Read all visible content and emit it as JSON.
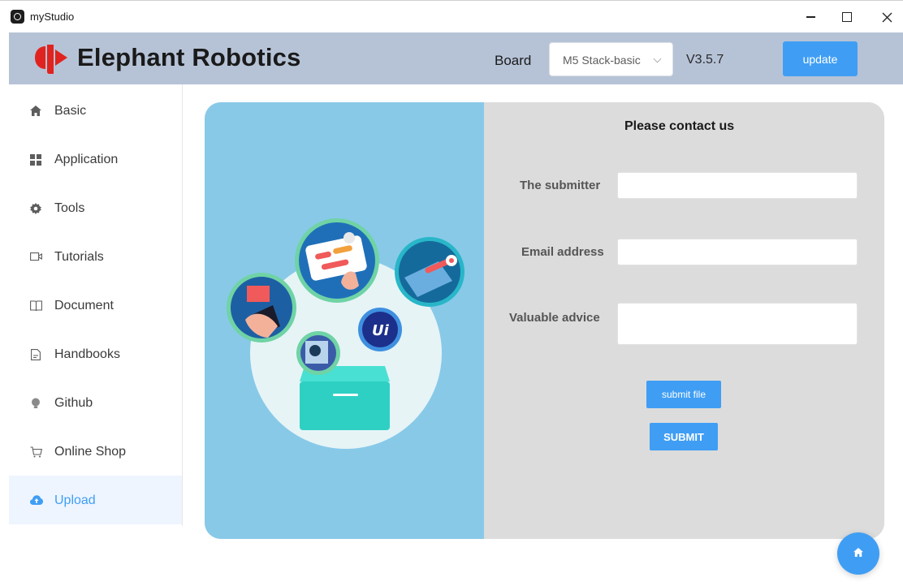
{
  "window": {
    "title": "myStudio"
  },
  "header": {
    "brand": "Elephant Robotics",
    "board_label": "Board",
    "board_value": "M5 Stack-basic",
    "version": "V3.5.7",
    "update_label": "update"
  },
  "sidebar": {
    "items": [
      {
        "label": "Basic",
        "icon": "home-icon"
      },
      {
        "label": "Application",
        "icon": "grid-icon"
      },
      {
        "label": "Tools",
        "icon": "gear-icon"
      },
      {
        "label": "Tutorials",
        "icon": "video-icon"
      },
      {
        "label": "Document",
        "icon": "book-icon"
      },
      {
        "label": "Handbooks",
        "icon": "file-icon"
      },
      {
        "label": "Github",
        "icon": "bulb-icon"
      },
      {
        "label": "Online Shop",
        "icon": "cart-icon"
      },
      {
        "label": "Upload",
        "icon": "cloud-upload-icon",
        "active": true
      }
    ]
  },
  "form": {
    "title": "Please contact us",
    "submitter_label": "The submitter",
    "submitter_value": "",
    "email_label": "Email address",
    "email_value": "",
    "advice_label": "Valuable advice",
    "advice_value": "",
    "submit_file_label": "submit file",
    "submit_label": "SUBMIT"
  },
  "colors": {
    "accent": "#3f9ef4",
    "header_bg": "#b6c3d7",
    "panel_left": "#88c9e8",
    "panel_right": "#dcdcdc",
    "logo_red": "#e0231f"
  }
}
